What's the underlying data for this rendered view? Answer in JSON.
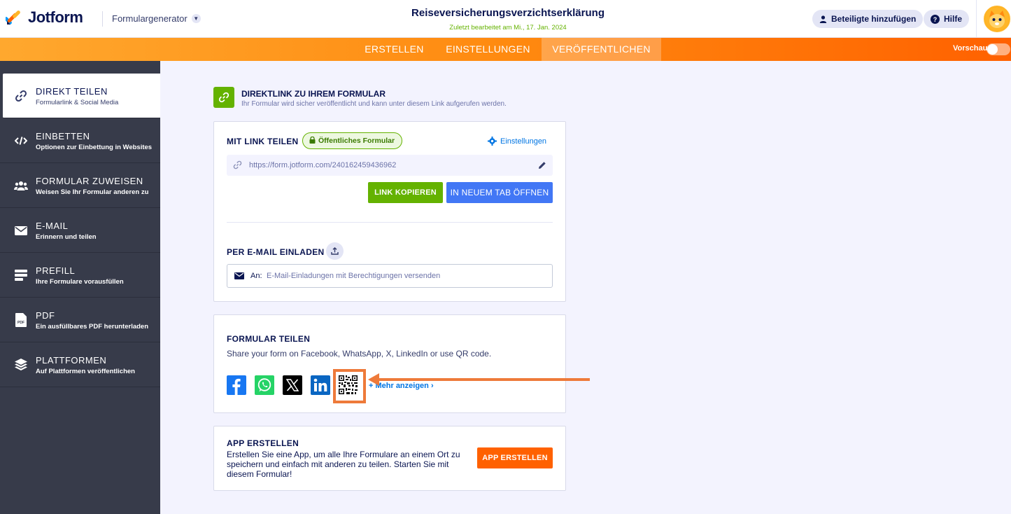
{
  "header": {
    "logo_text": "Jotform",
    "form_generator_label": "Formulargenerator",
    "form_title": "Reiseversicherungsverzichtserklärung",
    "last_edited": "Zuletzt bearbeitet am Mi., 17. Jan. 2024",
    "add_participants_label": "Beteiligte hinzufügen",
    "help_label": "Hilfe"
  },
  "nav": {
    "tabs": [
      {
        "label": "ERSTELLEN"
      },
      {
        "label": "EINSTELLUNGEN"
      },
      {
        "label": "VERÖFFENTLICHEN"
      }
    ],
    "active_tab": "VERÖFFENTLICHEN",
    "preview_label": "Vorschau",
    "preview_enabled": false
  },
  "sidebar": {
    "items": [
      {
        "title": "DIREKT TEILEN",
        "desc": "Formularlink & Social Media",
        "icon": "link-icon",
        "active": true
      },
      {
        "title": "EINBETTEN",
        "desc": "Optionen zur Einbettung in Websites",
        "icon": "code-icon"
      },
      {
        "title": "FORMULAR ZUWEISEN",
        "desc": "Weisen Sie Ihr Formular anderen zu",
        "icon": "users-icon"
      },
      {
        "title": "E-MAIL",
        "desc": "Erinnern und teilen",
        "icon": "envelope-icon"
      },
      {
        "title": "PREFILL",
        "desc": "Ihre Formulare vorausfüllen",
        "icon": "prefill-icon"
      },
      {
        "title": "PDF",
        "desc": "Ein ausfüllbares PDF herunterladen",
        "icon": "pdf-icon"
      },
      {
        "title": "PLATTFORMEN",
        "desc": "Auf Plattformen veröffentlichen",
        "icon": "layers-icon"
      }
    ]
  },
  "main": {
    "direct_link_title": "DIREKTLINK ZU IHREM FORMULAR",
    "direct_link_sub": "Ihr Formular wird sicher veröffentlicht und kann unter diesem Link aufgerufen werden.",
    "share_link_label": "MIT LINK TEILEN",
    "public_badge": "Öffentliches Formular",
    "settings_label": "Einstellungen",
    "form_url": "https://form.jotform.com/240162459436962",
    "copy_link_label": "LINK KOPIEREN",
    "open_new_tab_label": "IN NEUEM TAB ÖFFNEN",
    "email_invite_label": "PER E-MAIL EINLADEN",
    "email_to_label": "An:",
    "email_placeholder": "E-Mail-Einladungen mit Berechtigungen versenden",
    "share_form_label": "FORMULAR TEILEN",
    "share_form_desc": "Share your form on Facebook, WhatsApp, X, LinkedIn or use QR code.",
    "more_label": "+ Mehr anzeigen ›",
    "social": [
      "facebook-icon",
      "whatsapp-icon",
      "x-icon",
      "linkedin-icon",
      "qr-code-icon"
    ],
    "app_title": "APP ERSTELLEN",
    "app_desc": "Erstellen Sie eine App, um alle Ihre Formulare an einem Ort zu speichern und einfach mit anderen zu teilen. Starten Sie mit diesem Formular!",
    "app_button_label": "APP ERSTELLEN"
  },
  "colors": {
    "green": "#64b200",
    "blue": "#4277f5",
    "orange": "#ff6100",
    "annotation": "#ee7a3a",
    "sidebar": "#373b4a"
  }
}
